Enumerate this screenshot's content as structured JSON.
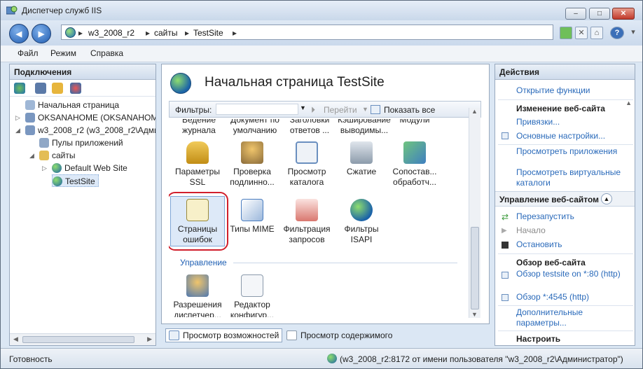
{
  "window": {
    "title": "Диспетчер служб IIS",
    "controls": {
      "minimize": "–",
      "maximize": "□",
      "close": "✕"
    }
  },
  "nav": {
    "back_glyph": "◀",
    "forward_glyph": "▶",
    "breadcrumb": [
      "w3_2008_r2",
      "сайты",
      "TestSite"
    ],
    "help_glyph": "?"
  },
  "menu": [
    "Файл",
    "Режим",
    "Справка"
  ],
  "connections": {
    "header": "Подключения",
    "tree": [
      {
        "label": "Начальная страница",
        "level": 0
      },
      {
        "label": "OKSANAHOME (OKSANAHOME",
        "level": 0
      },
      {
        "label": "w3_2008_r2 (w3_2008_r2\\Админ",
        "level": 0
      },
      {
        "label": "Пулы приложений",
        "level": 1
      },
      {
        "label": "сайты",
        "level": 1
      },
      {
        "label": "Default Web Site",
        "level": 2
      },
      {
        "label": "TestSite",
        "level": 2
      }
    ]
  },
  "center": {
    "title": "Начальная страница TestSite",
    "filter_label": "Фильтры:",
    "go_label": "Перейти",
    "show_all_label": "Показать все",
    "partial_row": [
      "Ведение журнала",
      "Документ по умолчанию",
      "Заголовки ответов ...",
      "Кэширование выводимы...",
      "Модули"
    ],
    "features": [
      {
        "label": "Параметры SSL",
        "icon": "lock-icon",
        "color": "#d6a21e"
      },
      {
        "label": "Проверка подлинно...",
        "icon": "user-lock-icon",
        "color": "#c98a2b"
      },
      {
        "label": "Просмотр каталога",
        "icon": "directory-browse-icon",
        "color": "#6a8fbf"
      },
      {
        "label": "Сжатие",
        "icon": "compression-icon",
        "color": "#8c9bab"
      },
      {
        "label": "Сопостав... обработч...",
        "icon": "handler-mappings-icon",
        "color": "#3f9a5a"
      },
      {
        "label": "Страницы ошибок",
        "icon": "error-pages-icon",
        "color": "#e9c13a"
      },
      {
        "label": "Типы MIME",
        "icon": "mime-types-icon",
        "color": "#4a7dc0"
      },
      {
        "label": "Фильтрация запросов",
        "icon": "request-filtering-icon",
        "color": "#c9463d"
      },
      {
        "label": "Фильтры ISAPI",
        "icon": "isapi-filters-icon",
        "color": "#2f9a4a"
      }
    ],
    "group_management": "Управление",
    "management": [
      {
        "label": "Разрешения диспетчер...",
        "icon": "permissions-icon",
        "color": "#6b8fc8"
      },
      {
        "label": "Редактор конфигур...",
        "icon": "config-editor-icon",
        "color": "#8b9aab"
      }
    ],
    "view_features": "Просмотр возможностей",
    "view_content": "Просмотр содержимого"
  },
  "actions": {
    "header": "Действия",
    "open_feature": "Открытие функции",
    "edit_site": "Изменение веб-сайта",
    "bindings": "Привязки...",
    "basic_settings": "Основные настройки...",
    "view_apps": "Просмотреть приложения",
    "view_vdirs": "Просмотреть виртуальные каталоги",
    "manage_site": "Управление веб-сайтом",
    "restart": "Перезапустить",
    "start": "Начало",
    "stop": "Остановить",
    "browse_site": "Обзор веб-сайта",
    "browse_80": "Обзор testsite on *:80 (http)",
    "browse_4545": "Обзор *:4545 (http)",
    "advanced": "Дополнительные параметры...",
    "configure": "Настроить"
  },
  "status": {
    "ready": "Готовность",
    "connection": "(w3_2008_r2:8172 от имени пользователя \"w3_2008_r2\\Администратор\")"
  },
  "colors": {
    "accent": "#2a6aba",
    "highlight": "#d11f2c",
    "selection": "#dde9f8"
  }
}
